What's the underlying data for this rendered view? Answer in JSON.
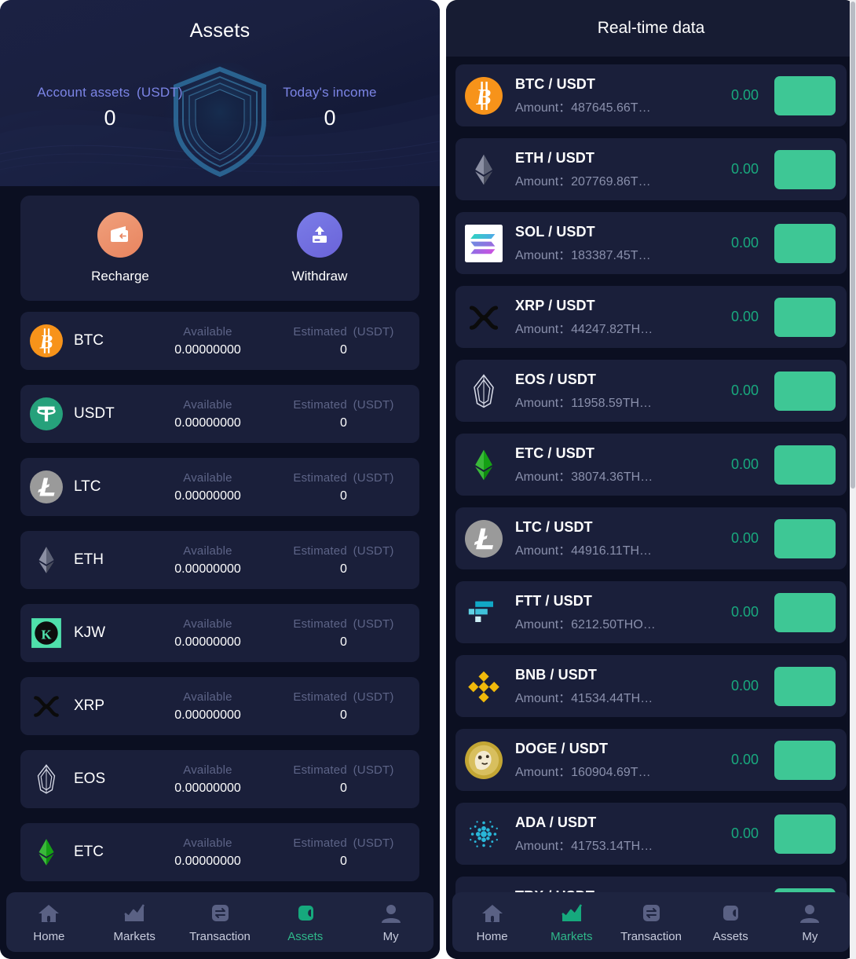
{
  "left": {
    "title": "Assets",
    "hero": {
      "account_label": "Account assets (USDT)",
      "account_value": "0",
      "income_label": "Today's income",
      "income_value": "0"
    },
    "actions": [
      {
        "label": "Recharge",
        "icon": "wallet-in-icon",
        "color": "#e8845f"
      },
      {
        "label": "Withdraw",
        "icon": "card-up-icon",
        "color": "#6a63d8"
      }
    ],
    "columns": {
      "available": "Available",
      "estimated": "Estimated (USDT)"
    },
    "assets": [
      {
        "symbol": "BTC",
        "icon": "btc-icon",
        "available": "0.00000000",
        "estimated": "0"
      },
      {
        "symbol": "USDT",
        "icon": "usdt-icon",
        "available": "0.00000000",
        "estimated": "0"
      },
      {
        "symbol": "LTC",
        "icon": "ltc-icon",
        "available": "0.00000000",
        "estimated": "0"
      },
      {
        "symbol": "ETH",
        "icon": "eth-icon",
        "available": "0.00000000",
        "estimated": "0"
      },
      {
        "symbol": "KJW",
        "icon": "kjw-icon",
        "available": "0.00000000",
        "estimated": "0"
      },
      {
        "symbol": "XRP",
        "icon": "xrp-icon",
        "available": "0.00000000",
        "estimated": "0"
      },
      {
        "symbol": "EOS",
        "icon": "eos-icon",
        "available": "0.00000000",
        "estimated": "0"
      },
      {
        "symbol": "ETC",
        "icon": "etc-icon",
        "available": "0.00000000",
        "estimated": "0"
      }
    ],
    "nav": {
      "active": "Assets",
      "items": [
        {
          "label": "Home",
          "icon": "home-icon"
        },
        {
          "label": "Markets",
          "icon": "chart-up-icon"
        },
        {
          "label": "Transaction",
          "icon": "exchange-icon"
        },
        {
          "label": "Assets",
          "icon": "wallet-icon"
        },
        {
          "label": "My",
          "icon": "user-icon"
        }
      ]
    }
  },
  "right": {
    "title": "Real-time data",
    "amount_prefix": "Amount：",
    "rows": [
      {
        "pair": "BTC / USDT",
        "icon": "btc-icon",
        "amount": "487645.66T…",
        "price": "0.00"
      },
      {
        "pair": "ETH / USDT",
        "icon": "eth-icon",
        "amount": "207769.86T…",
        "price": "0.00"
      },
      {
        "pair": "SOL / USDT",
        "icon": "sol-icon",
        "amount": "183387.45T…",
        "price": "0.00"
      },
      {
        "pair": "XRP / USDT",
        "icon": "xrp-icon",
        "amount": "44247.82TH…",
        "price": "0.00"
      },
      {
        "pair": "EOS / USDT",
        "icon": "eos-icon",
        "amount": "11958.59TH…",
        "price": "0.00"
      },
      {
        "pair": "ETC / USDT",
        "icon": "etc-icon",
        "amount": "38074.36TH…",
        "price": "0.00"
      },
      {
        "pair": "LTC / USDT",
        "icon": "ltc-icon",
        "amount": "44916.11TH…",
        "price": "0.00"
      },
      {
        "pair": "FTT / USDT",
        "icon": "ftt-icon",
        "amount": "6212.50THO…",
        "price": "0.00"
      },
      {
        "pair": "BNB / USDT",
        "icon": "bnb-icon",
        "amount": "41534.44TH…",
        "price": "0.00"
      },
      {
        "pair": "DOGE / USDT",
        "icon": "doge-icon",
        "amount": "160904.69T…",
        "price": "0.00"
      },
      {
        "pair": "ADA / USDT",
        "icon": "ada-icon",
        "amount": "41753.14TH…",
        "price": "0.00"
      },
      {
        "pair": "TRX / USDT",
        "icon": "trx-icon",
        "amount": "",
        "price": ""
      }
    ],
    "nav": {
      "active": "Markets",
      "items": [
        {
          "label": "Home",
          "icon": "home-icon"
        },
        {
          "label": "Markets",
          "icon": "chart-up-icon"
        },
        {
          "label": "Transaction",
          "icon": "exchange-icon"
        },
        {
          "label": "Assets",
          "icon": "wallet-icon"
        },
        {
          "label": "My",
          "icon": "user-icon"
        }
      ]
    }
  },
  "colors": {
    "accent_green": "#3ec795",
    "price_green": "#19a97e",
    "label_blue": "#7c85e6",
    "card_bg": "#1a1f3a",
    "page_bg": "#0b0f21"
  }
}
